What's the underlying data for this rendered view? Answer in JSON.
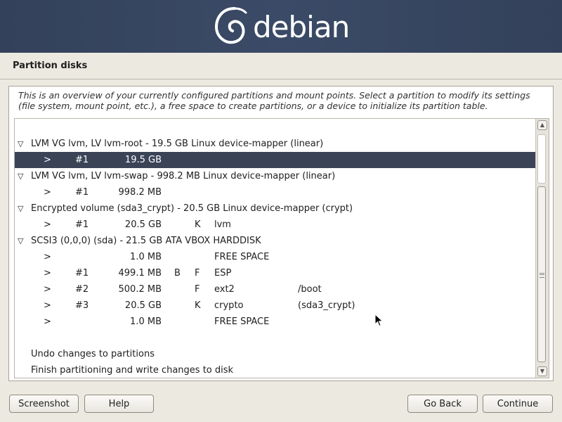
{
  "banner": {
    "logo_text": "debian"
  },
  "page_title": "Partition disks",
  "description": "This is an overview of your currently configured partitions and mount points. Select a partition to modify its settings (file system, mount point, etc.), a free space to create partitions, or a device to initialize its partition table.",
  "list": {
    "rows": [
      {
        "kind": "header",
        "tri": "▽",
        "text": "LVM VG lvm, LV lvm-root - 19.5 GB Linux device-mapper (linear)"
      },
      {
        "kind": "part",
        "selected": true,
        "arrow": ">",
        "num": "#1",
        "size": "19.5 GB",
        "flag1": "",
        "flag2": "",
        "fs": "",
        "mount": ""
      },
      {
        "kind": "header",
        "tri": "▽",
        "text": "LVM VG lvm, LV lvm-swap - 998.2 MB Linux device-mapper (linear)"
      },
      {
        "kind": "part",
        "arrow": ">",
        "num": "#1",
        "size": "998.2 MB",
        "flag1": "",
        "flag2": "",
        "fs": "",
        "mount": ""
      },
      {
        "kind": "header",
        "tri": "▽",
        "text": "Encrypted volume (sda3_crypt) - 20.5 GB Linux device-mapper (crypt)"
      },
      {
        "kind": "part",
        "arrow": ">",
        "num": "#1",
        "size": "20.5 GB",
        "flag1": "",
        "flag2": "K",
        "fs": "lvm",
        "mount": ""
      },
      {
        "kind": "header",
        "tri": "▽",
        "text": "SCSI3 (0,0,0) (sda) - 21.5 GB ATA VBOX HARDDISK"
      },
      {
        "kind": "part",
        "arrow": ">",
        "num": "",
        "size": "1.0 MB",
        "flag1": "",
        "flag2": "",
        "fs": "FREE SPACE",
        "mount": ""
      },
      {
        "kind": "part",
        "arrow": ">",
        "num": "#1",
        "size": "499.1 MB",
        "flag1": "B",
        "flag2": "F",
        "fs": "ESP",
        "mount": ""
      },
      {
        "kind": "part",
        "arrow": ">",
        "num": "#2",
        "size": "500.2 MB",
        "flag1": "",
        "flag2": "F",
        "fs": "ext2",
        "mount": "/boot"
      },
      {
        "kind": "part",
        "arrow": ">",
        "num": "#3",
        "size": "20.5 GB",
        "flag1": "",
        "flag2": "K",
        "fs": "crypto",
        "mount": "(sda3_crypt)"
      },
      {
        "kind": "part",
        "arrow": ">",
        "num": "",
        "size": "1.0 MB",
        "flag1": "",
        "flag2": "",
        "fs": "FREE SPACE",
        "mount": ""
      },
      {
        "kind": "blank"
      },
      {
        "kind": "action",
        "text": "Undo changes to partitions"
      },
      {
        "kind": "action",
        "text": "Finish partitioning and write changes to disk"
      }
    ]
  },
  "scrollbar": {
    "up_icon": "▲",
    "down_icon": "▼"
  },
  "buttons": {
    "screenshot": "Screenshot",
    "help": "Help",
    "go_back": "Go Back",
    "continue": "Continue"
  },
  "colors": {
    "banner": "#33415a",
    "selection": "#3b4457",
    "background": "#ece9e1"
  }
}
